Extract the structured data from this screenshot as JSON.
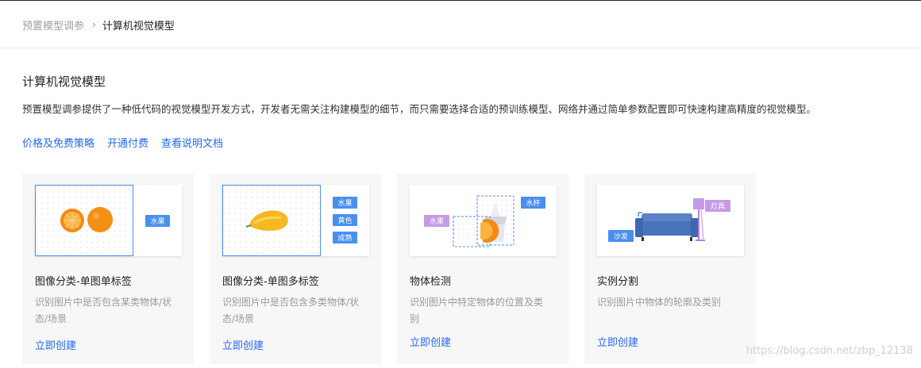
{
  "breadcrumb": {
    "parent": "预置模型调参",
    "separator": "›",
    "current": "计算机视觉模型"
  },
  "page": {
    "title": "计算机视觉模型",
    "description": "预置模型调参提供了一种低代码的视觉模型开发方式，开发者无需关注构建模型的细节，而只需要选择合适的预训练模型、网络并通过简单参数配置即可快速构建高精度的视觉模型。"
  },
  "links": {
    "pricing": "价格及免费策略",
    "activate": "开通付费",
    "docs": "查看说明文档"
  },
  "cards": [
    {
      "title": "图像分类-单图单标签",
      "desc": "识别图片中是否包含某类物体/状态/场景",
      "action": "立即创建",
      "tags": [
        "水果"
      ]
    },
    {
      "title": "图像分类-单图多标签",
      "desc": "识别图片中是否包含多类物体/状态/场景",
      "action": "立即创建",
      "tags": [
        "水果",
        "黄色",
        "成熟"
      ]
    },
    {
      "title": "物体检测",
      "desc": "识别图片中特定物体的位置及类别",
      "action": "立即创建",
      "tags": [
        "水果",
        "水杯"
      ]
    },
    {
      "title": "实例分割",
      "desc": "识别图片中物体的轮廓及类别",
      "action": "立即创建",
      "tags": [
        "沙发",
        "灯具"
      ]
    }
  ],
  "watermark": "https://blog.csdn.net/zbp_12138",
  "colors": {
    "link": "#2468f2",
    "tag_blue": "#4a8ff0",
    "tag_purple": "#c59be8"
  }
}
